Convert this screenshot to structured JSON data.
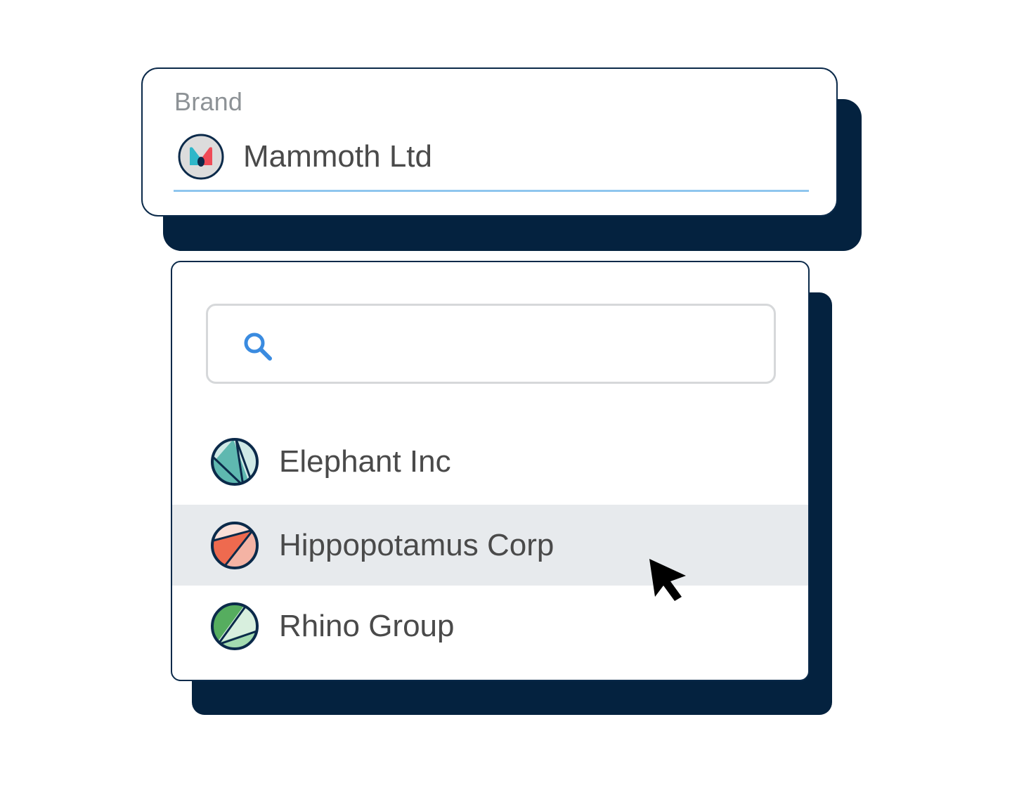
{
  "brand_field": {
    "label": "Brand",
    "value": "Mammoth Ltd",
    "logo_icon": "mammoth-logo-icon"
  },
  "dropdown": {
    "search": {
      "icon": "search-icon",
      "placeholder": "",
      "value": ""
    },
    "options": [
      {
        "label": "Elephant Inc",
        "icon": "elephant-logo-icon",
        "highlighted": false,
        "colors": [
          "#cfe9e6",
          "#5fb8b0"
        ]
      },
      {
        "label": "Hippopotamus Corp",
        "icon": "hippopotamus-logo-icon",
        "highlighted": true,
        "colors": [
          "#fbe0d8",
          "#ee6a4f",
          "#f4b3a4"
        ]
      },
      {
        "label": "Rhino Group",
        "icon": "rhino-logo-icon",
        "highlighted": false,
        "colors": [
          "#56ad5f",
          "#d8efde",
          "#a3dbb0"
        ]
      }
    ]
  },
  "colors": {
    "card_border": "#0b2a4a",
    "shadow": "#04223f",
    "underline_accent": "#8fc6ee",
    "search_icon": "#3a8be0",
    "highlight_bg": "#e7eaed",
    "label_gray": "#8d9296",
    "text": "#4a4a4a"
  }
}
